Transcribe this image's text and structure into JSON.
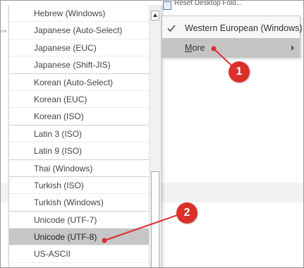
{
  "background": {
    "edge_text": "o th",
    "toolbar_label": "Reset Desktop Fold..."
  },
  "encoding_menu": {
    "items": [
      {
        "label": "Western European (Windows)",
        "checked": true
      },
      {
        "label_prefix": "M",
        "label_rest": "ore",
        "has_submenu": true,
        "highlighted": true
      }
    ]
  },
  "more_submenu": {
    "items": [
      {
        "label": "Hebrew (Windows)"
      },
      {
        "label": "Japanese (Auto-Select)"
      },
      {
        "label": "Japanese (EUC)"
      },
      {
        "label": "Japanese (Shift-JIS)"
      },
      {
        "label": "Korean (Auto-Select)"
      },
      {
        "label": "Korean (EUC)"
      },
      {
        "label": "Korean (ISO)"
      },
      {
        "label": "Latin 3 (ISO)"
      },
      {
        "label": "Latin 9 (ISO)"
      },
      {
        "label": "Thai (Windows)"
      },
      {
        "label": "Turkish (ISO)"
      },
      {
        "label": "Turkish (Windows)"
      },
      {
        "label": "Unicode (UTF-7)"
      },
      {
        "label": "Unicode (UTF-8)",
        "selected": true
      },
      {
        "label": "US-ASCII"
      }
    ]
  },
  "callouts": [
    {
      "number": "1"
    },
    {
      "number": "2"
    }
  ],
  "colors": {
    "callout": "#d9302a",
    "highlight": "#c4c4c4",
    "selected_item": "#c6c6c6"
  }
}
